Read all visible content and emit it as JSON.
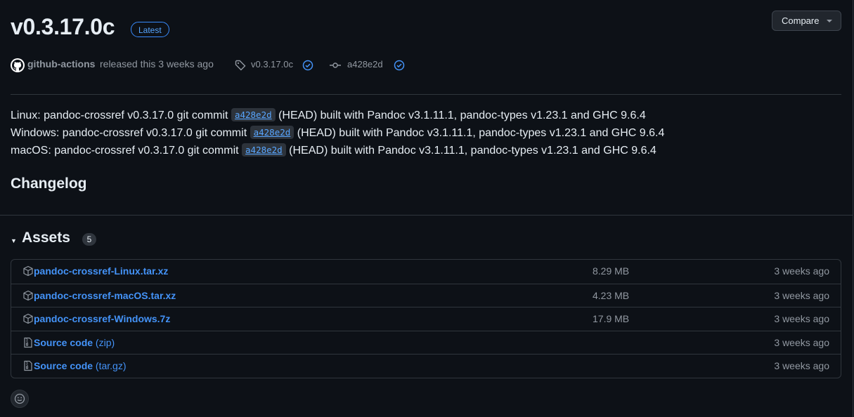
{
  "release": {
    "title": "v0.3.17.0c",
    "badge": "Latest",
    "compare_label": "Compare"
  },
  "meta": {
    "author": "github-actions",
    "released_text": "released this 3 weeks ago",
    "tag": "v0.3.17.0c",
    "commit": "a428e2d"
  },
  "body": {
    "lines": [
      {
        "prefix": "Linux: pandoc-crossref v0.3.17.0 git commit",
        "commit": "a428e2d",
        "suffix": "(HEAD) built with Pandoc v3.1.11.1, pandoc-types v1.23.1 and GHC 9.6.4"
      },
      {
        "prefix": "Windows: pandoc-crossref v0.3.17.0 git commit",
        "commit": "a428e2d",
        "suffix": "(HEAD) built with Pandoc v3.1.11.1, pandoc-types v1.23.1 and GHC 9.6.4"
      },
      {
        "prefix": "macOS: pandoc-crossref v0.3.17.0 git commit",
        "commit": "a428e2d",
        "suffix": "(HEAD) built with Pandoc v3.1.11.1, pandoc-types v1.23.1 and GHC 9.6.4"
      }
    ],
    "changelog_heading": "Changelog"
  },
  "assets": {
    "heading": "Assets",
    "count": "5",
    "items": [
      {
        "icon": "package-icon",
        "name": "pandoc-crossref-Linux.tar.xz",
        "suffix": "",
        "size": "8.29 MB",
        "time": "3 weeks ago"
      },
      {
        "icon": "package-icon",
        "name": "pandoc-crossref-macOS.tar.xz",
        "suffix": "",
        "size": "4.23 MB",
        "time": "3 weeks ago"
      },
      {
        "icon": "package-icon",
        "name": "pandoc-crossref-Windows.7z",
        "suffix": "",
        "size": "17.9 MB",
        "time": "3 weeks ago"
      },
      {
        "icon": "file-zip-icon",
        "name": "Source code",
        "suffix": "(zip)",
        "size": "",
        "time": "3 weeks ago"
      },
      {
        "icon": "file-zip-icon",
        "name": "Source code",
        "suffix": "(tar.gz)",
        "size": "",
        "time": "3 weeks ago"
      }
    ]
  },
  "colors": {
    "background": "#0d1117",
    "link": "#4493f8",
    "muted": "#9198a1",
    "border": "#30363d",
    "accent": "#388bfd"
  }
}
